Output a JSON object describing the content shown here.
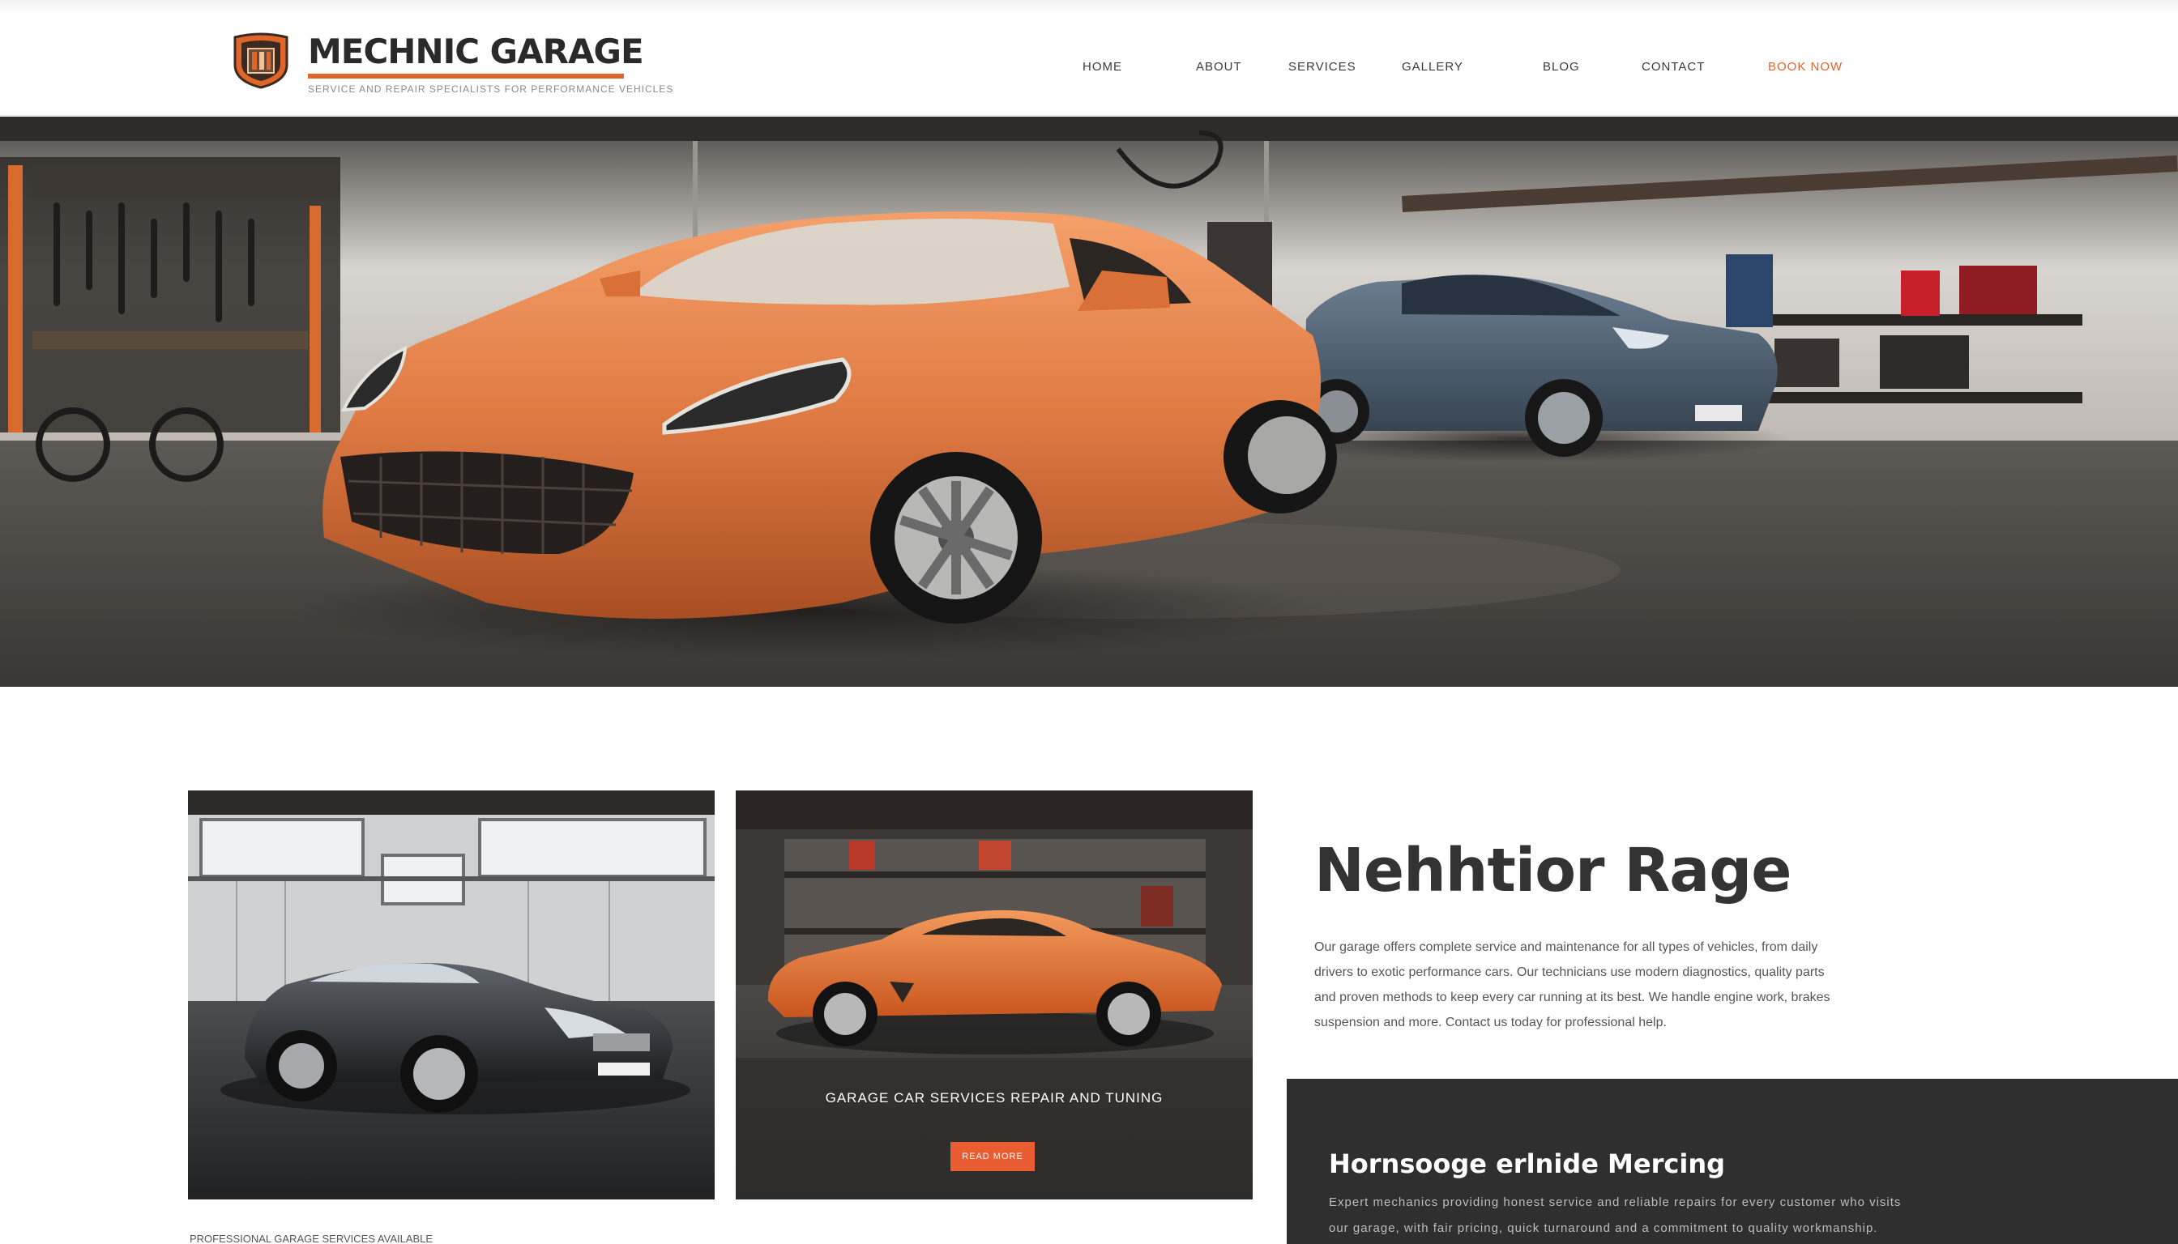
{
  "brand": {
    "name": "MECHNIC GARAGE",
    "tagline": "SERVICE AND REPAIR SPECIALISTS FOR PERFORMANCE VEHICLES",
    "accent_color": "#e0652b",
    "logo_icon": "garage-shield-logo-icon"
  },
  "nav": {
    "items": [
      "HOME",
      "ABOUT",
      "SERVICES",
      "GALLERY",
      "BLOG",
      "CONTACT",
      "BOOK NOW"
    ],
    "active_index": 6
  },
  "hero": {
    "image": "orange-sports-car-in-garage"
  },
  "cards": [
    {
      "image": "black-coupe-in-garage"
    },
    {
      "image": "orange-coupe-in-workshop",
      "caption": "GARAGE CAR SERVICES REPAIR AND TUNING",
      "button_label": "READ MORE"
    }
  ],
  "intro": {
    "title": "Nehhtior Rage",
    "lines": [
      "Our garage offers complete service and maintenance for all types of vehicles, from daily",
      "drivers to exotic performance cars. Our technicians use modern diagnostics, quality parts",
      "and proven methods to keep every car running at its best. We handle engine work, brakes",
      "suspension and more. Contact us today for professional help."
    ]
  },
  "panel": {
    "title": "Hornsooge erlnide Mercing",
    "lines": [
      "Expert mechanics providing honest service and reliable repairs for every customer who visits",
      "our garage, with fair pricing, quick turnaround and a commitment to quality workmanship."
    ]
  },
  "footnote": "PROFESSIONAL GARAGE SERVICES AVAILABLE"
}
